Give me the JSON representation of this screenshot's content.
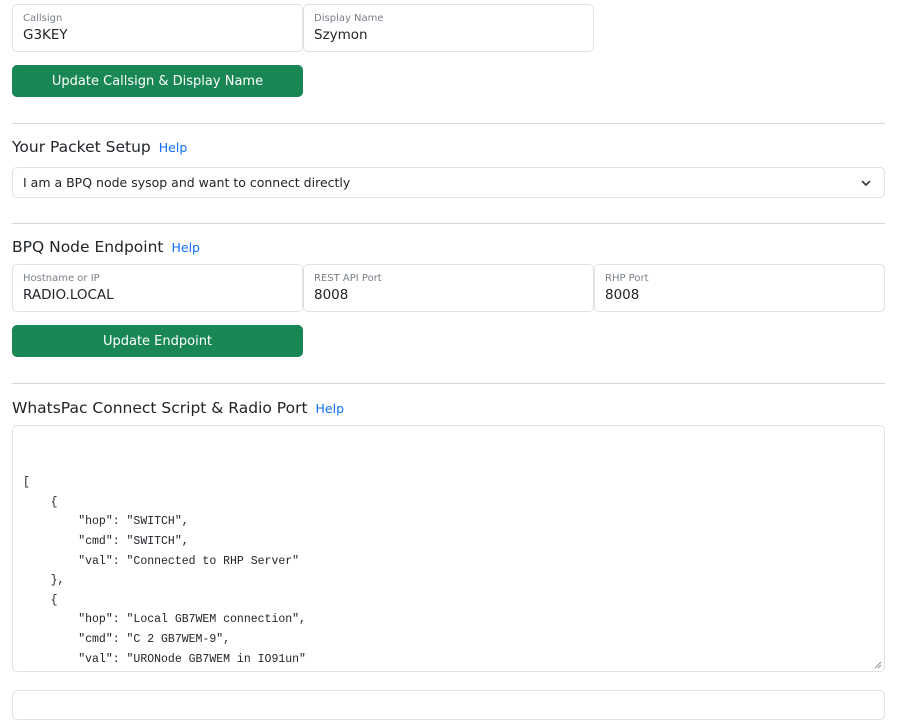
{
  "identity": {
    "callsign_label": "Callsign",
    "callsign_value": "G3KEY",
    "display_name_label": "Display Name",
    "display_name_value": "Szymon",
    "update_button": "Update Callsign & Display Name"
  },
  "packet_setup": {
    "title": "Your Packet Setup",
    "help": "Help",
    "selected_option": "I am a BPQ node sysop and want to connect directly"
  },
  "endpoint": {
    "title": "BPQ Node Endpoint",
    "help": "Help",
    "hostname_label": "Hostname or IP",
    "hostname_value": "RADIO.LOCAL",
    "rest_port_label": "REST API Port",
    "rest_port_value": "8008",
    "rhp_port_label": "RHP Port",
    "rhp_port_value": "8008",
    "update_button": "Update Endpoint"
  },
  "connect_script": {
    "title": "WhatsPac Connect Script & Radio Port",
    "help": "Help",
    "lines": [
      "[",
      "    {",
      "        \"hop\": \"SWITCH\",",
      "        \"cmd\": \"SWITCH\",",
      "        \"val\": \"Connected to RHP Server\"",
      "    },",
      "    {",
      "        \"hop\": \"Local GB7WEM connection\",",
      "        \"cmd\": \"C 2 GB7WEM-9\",",
      "        \"val\": \"URONode GB7WEM in IO91un\"",
      "    },",
      "    {"
    ]
  }
}
